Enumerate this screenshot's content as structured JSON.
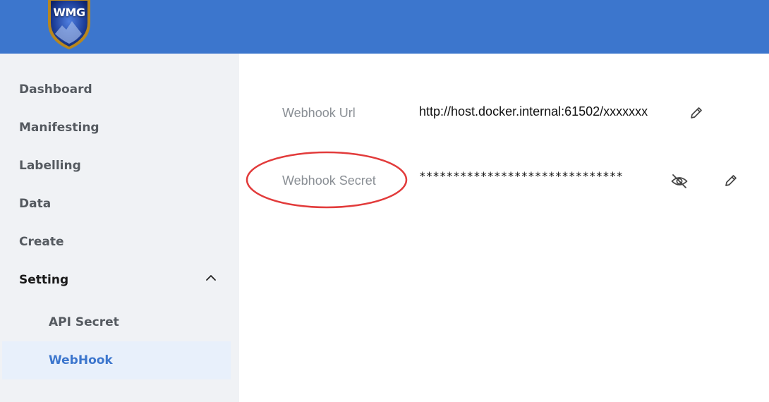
{
  "header": {
    "logo_text": "WMG",
    "brand_color": "#3c76cd"
  },
  "sidebar": {
    "items": [
      {
        "label": "Dashboard"
      },
      {
        "label": "Manifesting"
      },
      {
        "label": "Labelling"
      },
      {
        "label": "Data"
      },
      {
        "label": "Create"
      },
      {
        "label": "Setting"
      }
    ],
    "setting_children": [
      {
        "label": "API Secret"
      },
      {
        "label": "WebHook"
      }
    ],
    "expanded_icon": "chevron-up-icon",
    "selected_color": "#3c76cd"
  },
  "main": {
    "webhook_url": {
      "label": "Webhook Url",
      "value": "http://host.docker.internal:61502/xxxxxxx",
      "edit_icon": "pencil-icon"
    },
    "webhook_secret": {
      "label": "Webhook Secret",
      "value": "******************************",
      "visibility_icon": "eye-off-icon",
      "edit_icon": "pencil-icon"
    }
  },
  "annotation": {
    "shape": "ellipse",
    "color": "#e23b3b",
    "target": "webhook-secret-label"
  }
}
